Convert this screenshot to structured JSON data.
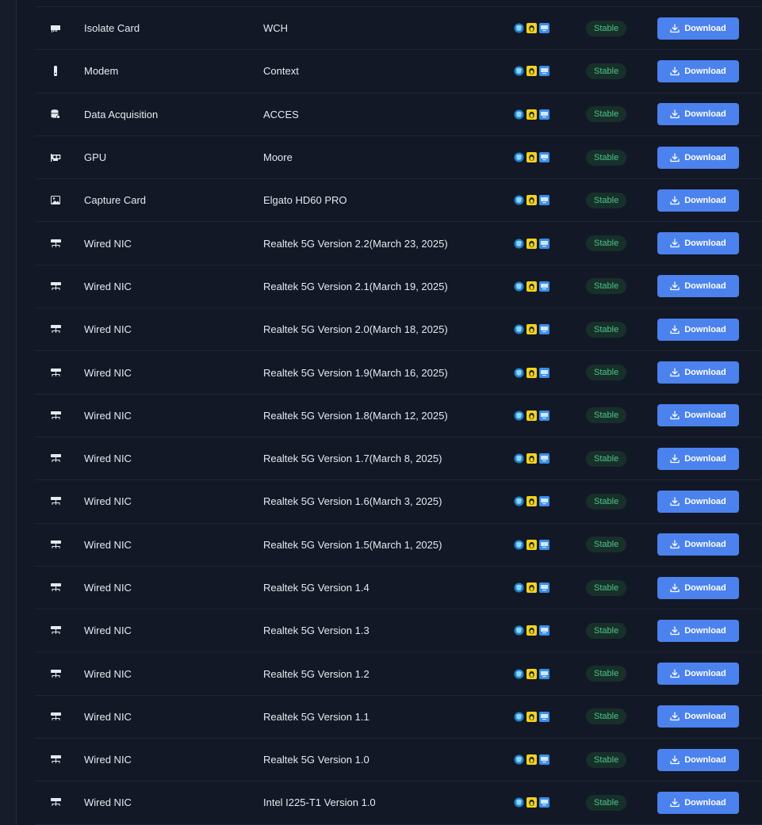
{
  "colors": {
    "background": "#131826",
    "row_border": "#1e2536",
    "text": "#e6e9f0",
    "badge_bg": "#17302a",
    "badge_text": "#4ec38a",
    "button_bg": "#4b82ee",
    "button_text": "#ffffff"
  },
  "rows": [
    {
      "icon": "isolate-card-icon",
      "type": "Isolate Card",
      "model": "WCH",
      "os": [
        "windows-icon",
        "linux-icon",
        "macos-icon"
      ],
      "status": "Stable",
      "action": "Download"
    },
    {
      "icon": "modem-icon",
      "type": "Modem",
      "model": "Context",
      "os": [
        "windows-icon",
        "linux-icon",
        "macos-icon"
      ],
      "status": "Stable",
      "action": "Download"
    },
    {
      "icon": "database-icon",
      "type": "Data Acquisition",
      "model": "ACCES",
      "os": [
        "windows-icon",
        "linux-icon",
        "macos-icon"
      ],
      "status": "Stable",
      "action": "Download"
    },
    {
      "icon": "gpu-icon",
      "type": "GPU",
      "model": "Moore",
      "os": [
        "windows-icon",
        "linux-icon",
        "macos-icon"
      ],
      "status": "Stable",
      "action": "Download"
    },
    {
      "icon": "image-icon",
      "type": "Capture Card",
      "model": "Elgato HD60 PRO",
      "os": [
        "windows-icon",
        "linux-icon",
        "macos-icon"
      ],
      "status": "Stable",
      "action": "Download"
    },
    {
      "icon": "network-icon",
      "type": "Wired NIC",
      "model": "Realtek 5G Version 2.2(March 23, 2025)",
      "os": [
        "windows-icon",
        "linux-icon",
        "macos-icon"
      ],
      "status": "Stable",
      "action": "Download"
    },
    {
      "icon": "network-icon",
      "type": "Wired NIC",
      "model": "Realtek 5G Version 2.1(March 19, 2025)",
      "os": [
        "windows-icon",
        "linux-icon",
        "macos-icon"
      ],
      "status": "Stable",
      "action": "Download"
    },
    {
      "icon": "network-icon",
      "type": "Wired NIC",
      "model": "Realtek 5G Version 2.0(March 18, 2025)",
      "os": [
        "windows-icon",
        "linux-icon",
        "macos-icon"
      ],
      "status": "Stable",
      "action": "Download"
    },
    {
      "icon": "network-icon",
      "type": "Wired NIC",
      "model": "Realtek 5G Version 1.9(March 16, 2025)",
      "os": [
        "windows-icon",
        "linux-icon",
        "macos-icon"
      ],
      "status": "Stable",
      "action": "Download"
    },
    {
      "icon": "network-icon",
      "type": "Wired NIC",
      "model": "Realtek 5G Version 1.8(March 12, 2025)",
      "os": [
        "windows-icon",
        "linux-icon",
        "macos-icon"
      ],
      "status": "Stable",
      "action": "Download"
    },
    {
      "icon": "network-icon",
      "type": "Wired NIC",
      "model": "Realtek 5G Version 1.7(March 8, 2025)",
      "os": [
        "windows-icon",
        "linux-icon",
        "macos-icon"
      ],
      "status": "Stable",
      "action": "Download"
    },
    {
      "icon": "network-icon",
      "type": "Wired NIC",
      "model": "Realtek 5G Version 1.6(March 3, 2025)",
      "os": [
        "windows-icon",
        "linux-icon",
        "macos-icon"
      ],
      "status": "Stable",
      "action": "Download"
    },
    {
      "icon": "network-icon",
      "type": "Wired NIC",
      "model": "Realtek 5G Version 1.5(March 1, 2025)",
      "os": [
        "windows-icon",
        "linux-icon",
        "macos-icon"
      ],
      "status": "Stable",
      "action": "Download"
    },
    {
      "icon": "network-icon",
      "type": "Wired NIC",
      "model": "Realtek 5G Version 1.4",
      "os": [
        "windows-icon",
        "linux-icon",
        "macos-icon"
      ],
      "status": "Stable",
      "action": "Download"
    },
    {
      "icon": "network-icon",
      "type": "Wired NIC",
      "model": "Realtek 5G Version 1.3",
      "os": [
        "windows-icon",
        "linux-icon",
        "macos-icon"
      ],
      "status": "Stable",
      "action": "Download"
    },
    {
      "icon": "network-icon",
      "type": "Wired NIC",
      "model": "Realtek 5G Version 1.2",
      "os": [
        "windows-icon",
        "linux-icon",
        "macos-icon"
      ],
      "status": "Stable",
      "action": "Download"
    },
    {
      "icon": "network-icon",
      "type": "Wired NIC",
      "model": "Realtek 5G Version 1.1",
      "os": [
        "windows-icon",
        "linux-icon",
        "macos-icon"
      ],
      "status": "Stable",
      "action": "Download"
    },
    {
      "icon": "network-icon",
      "type": "Wired NIC",
      "model": "Realtek 5G Version 1.0",
      "os": [
        "windows-icon",
        "linux-icon",
        "macos-icon"
      ],
      "status": "Stable",
      "action": "Download"
    },
    {
      "icon": "network-icon",
      "type": "Wired NIC",
      "model": "Intel I225-T1 Version 1.0",
      "os": [
        "windows-icon",
        "linux-icon",
        "macos-icon"
      ],
      "status": "Stable",
      "action": "Download"
    }
  ]
}
